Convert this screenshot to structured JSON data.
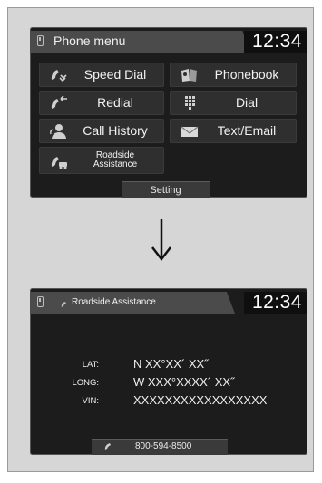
{
  "screen1": {
    "header_title": "Phone menu",
    "clock": "12:34",
    "buttons": [
      {
        "label": "Speed Dial",
        "icon": "speed-dial-icon"
      },
      {
        "label": "Phonebook",
        "icon": "phonebook-icon"
      },
      {
        "label": "Redial",
        "icon": "redial-icon"
      },
      {
        "label": "Dial",
        "icon": "keypad-icon"
      },
      {
        "label": "Call History",
        "icon": "call-history-icon"
      },
      {
        "label": "Text/Email",
        "icon": "envelope-icon"
      },
      {
        "label": "Roadside\nAssistance",
        "icon": "roadside-icon"
      }
    ],
    "setting_label": "Setting"
  },
  "screen2": {
    "header_title": "Roadside Assistance",
    "clock": "12:34",
    "lat_label": "LAT:",
    "lat_value": "N XX°XX´ XX˝",
    "long_label": "LONG:",
    "long_value": "W XXX°XXXX´ XX˝",
    "vin_label": "VIN:",
    "vin_value": "XXXXXXXXXXXXXXXXX",
    "phone_number": "800-594-8500"
  },
  "colors": {
    "screen_bg": "#1c1c1c",
    "button_bg": "#2f2f2f",
    "header_band": "#4b4b4b",
    "frame_bg": "#d6d6d6"
  }
}
